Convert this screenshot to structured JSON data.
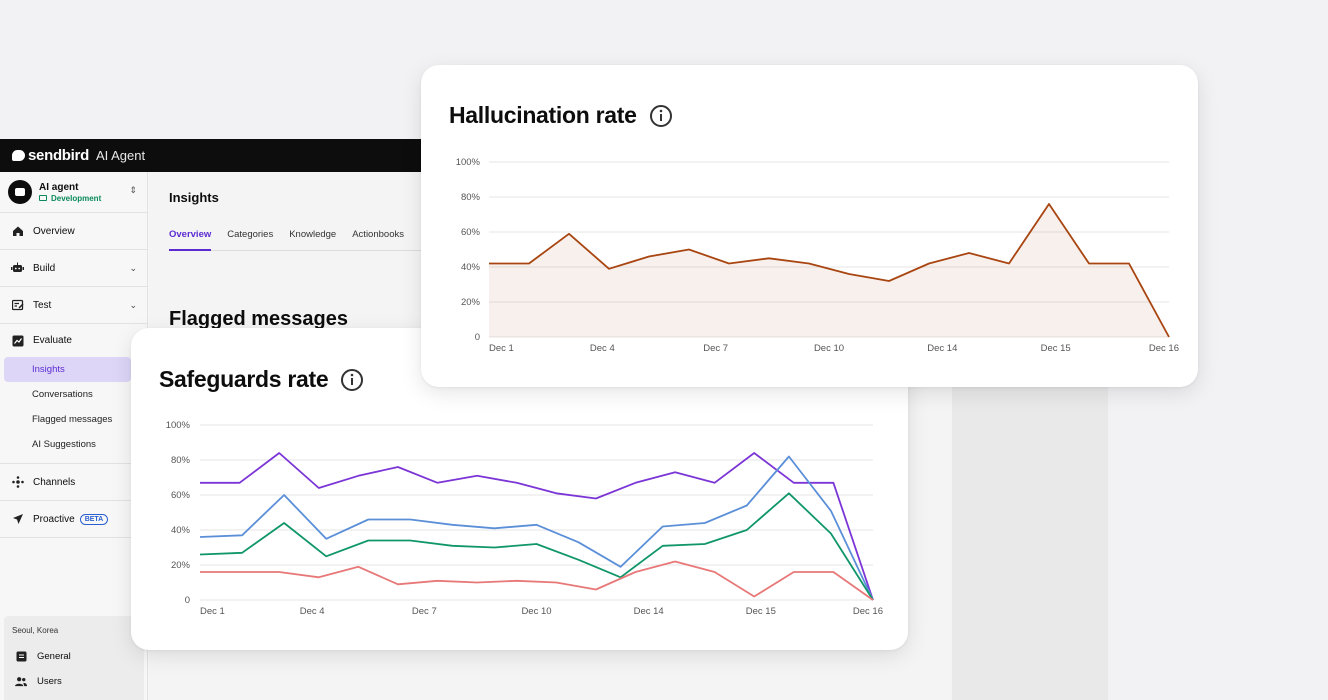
{
  "app": {
    "logo_text": "sendbird",
    "product": "AI Agent"
  },
  "agent": {
    "name": "AI agent",
    "environment": "Development"
  },
  "nav": {
    "overview": "Overview",
    "build": "Build",
    "test": "Test",
    "evaluate": "Evaluate",
    "evaluate_items": [
      "Insights",
      "Conversations",
      "Flagged messages",
      "AI Suggestions"
    ],
    "channels": "Channels",
    "proactive": "Proactive",
    "proactive_badge": "BETA"
  },
  "footer": {
    "location": "Seoul, Korea",
    "general": "General",
    "users": "Users"
  },
  "main": {
    "title": "Insights",
    "tabs": [
      "Overview",
      "Categories",
      "Knowledge",
      "Actionbooks"
    ],
    "section_title": "Flagged messages"
  },
  "colors": {
    "accent": "#5b2bd1",
    "hallucination": "#a84510",
    "safeguard_purple": "#7b35d6",
    "safeguard_blue": "#5b8fd8",
    "safeguard_green": "#10966a",
    "safeguard_red": "#e87878"
  },
  "chart_data": [
    {
      "type": "area",
      "title": "Hallucination rate",
      "x_ticks": [
        "Dec 1",
        "Dec 4",
        "Dec 7",
        "Dec 10",
        "Dec 14",
        "Dec 15",
        "Dec 16"
      ],
      "y_ticks": [
        "0",
        "20%",
        "40%",
        "60%",
        "80%",
        "100%"
      ],
      "ylim": [
        0,
        100
      ],
      "grid": true,
      "series": [
        {
          "values": [
            42,
            42,
            59,
            39,
            46,
            50,
            42,
            45,
            42,
            36,
            32,
            42,
            48,
            42,
            76,
            42,
            42,
            0
          ]
        }
      ]
    },
    {
      "type": "line",
      "title": "Safeguards rate",
      "x_ticks": [
        "Dec 1",
        "Dec 4",
        "Dec 7",
        "Dec 10",
        "Dec 14",
        "Dec 15",
        "Dec 16"
      ],
      "y_ticks": [
        "0",
        "20%",
        "40%",
        "60%",
        "80%",
        "100%"
      ],
      "ylim": [
        0,
        100
      ],
      "grid": true,
      "series": [
        {
          "values": [
            67,
            67,
            84,
            64,
            71,
            76,
            67,
            71,
            67,
            61,
            58,
            67,
            73,
            67,
            84,
            67,
            67,
            0
          ]
        },
        {
          "values": [
            36,
            37,
            60,
            35,
            46,
            46,
            43,
            41,
            43,
            33,
            19,
            42,
            44,
            54,
            82,
            51,
            0
          ]
        },
        {
          "values": [
            26,
            27,
            44,
            25,
            34,
            34,
            31,
            30,
            32,
            23,
            13,
            31,
            32,
            40,
            61,
            38,
            0
          ]
        },
        {
          "values": [
            16,
            16,
            16,
            13,
            19,
            9,
            11,
            10,
            11,
            10,
            6,
            16,
            22,
            16,
            2,
            16,
            16,
            0
          ]
        }
      ]
    }
  ]
}
